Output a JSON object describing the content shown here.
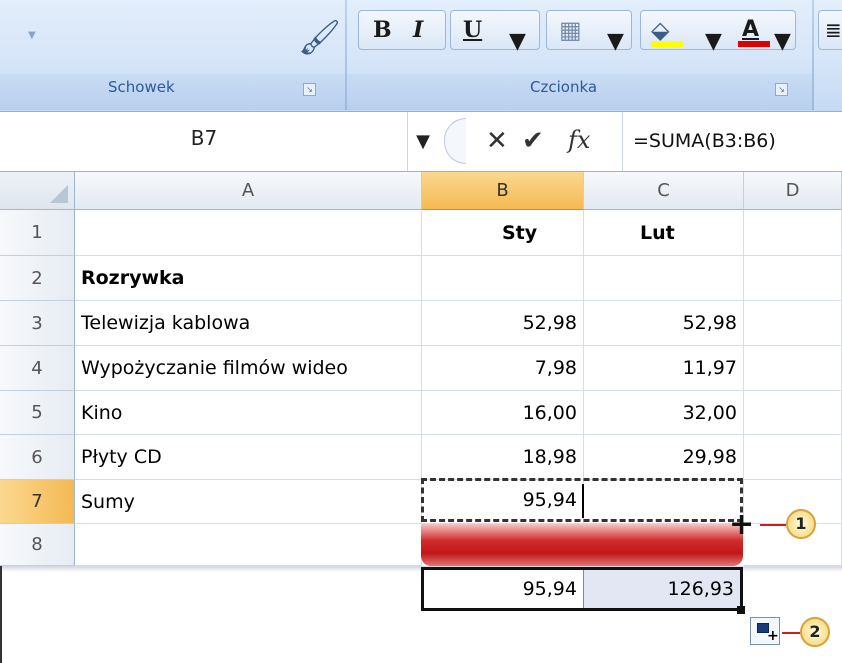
{
  "ribbon": {
    "groups": [
      {
        "name": "Schowek"
      },
      {
        "name": "Czcionka"
      }
    ],
    "buttons": {
      "bold": "B",
      "italic": "I",
      "underline": "U",
      "font_color": "A"
    }
  },
  "formula_bar": {
    "name_box": "B7",
    "formula": "=SUMA(B3:B6)",
    "fx": "fx"
  },
  "grid": {
    "columns": [
      "A",
      "B",
      "C",
      "D"
    ],
    "rows": [
      "1",
      "2",
      "3",
      "4",
      "5",
      "6",
      "7",
      "8"
    ],
    "cells": {
      "B1": "Sty",
      "C1": "Lut",
      "A2": "Rozrywka",
      "A3": "Telewizja kablowa",
      "B3": "52,98",
      "C3": "52,98",
      "A4": "Wypożyczanie filmów wideo",
      "B4": "7,98",
      "C4": "11,97",
      "A5": "Kino",
      "B5": "16,00",
      "C5": "32,00",
      "A6": "Płyty CD",
      "B6": "18,98",
      "C6": "29,98",
      "A7": "Sumy",
      "B7": "95,94"
    },
    "active_column": "B",
    "active_row": "7"
  },
  "result": {
    "b": "95,94",
    "c": "126,93"
  },
  "callouts": [
    "1",
    "2"
  ],
  "colors": {
    "accent_header": "#f4b953",
    "drag_band": "#c01818",
    "callout": "#f5d36c"
  }
}
